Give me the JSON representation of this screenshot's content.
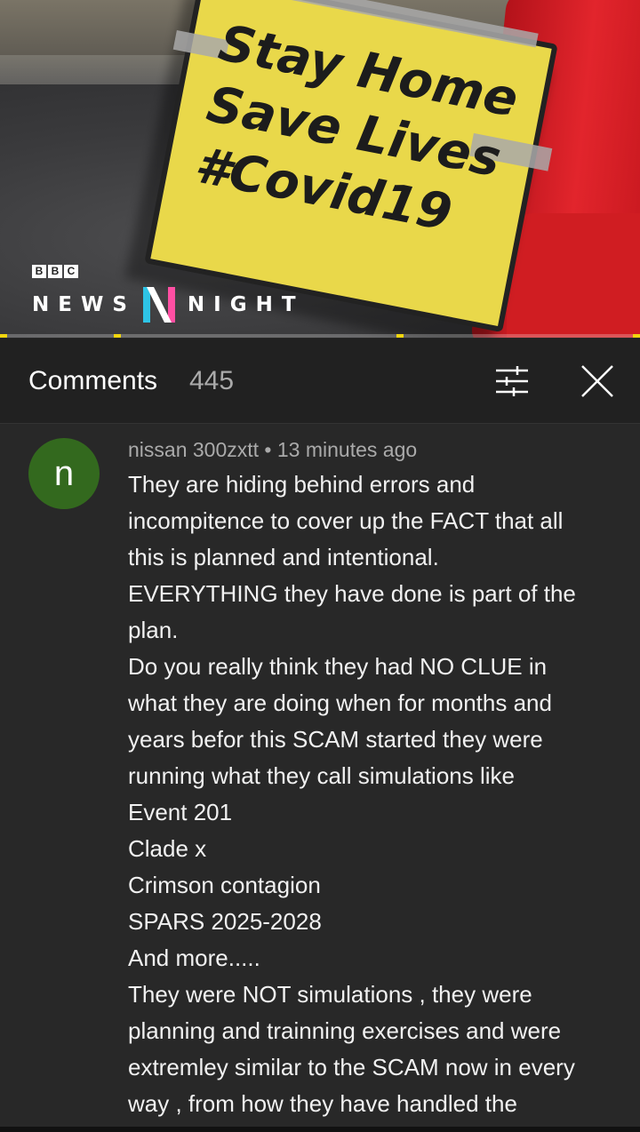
{
  "video": {
    "sign_lines": [
      "Stay Home",
      "Save Lives",
      "#Covid19"
    ],
    "brand": {
      "bbc_letters": [
        "B",
        "B",
        "C"
      ],
      "news": "NEWS",
      "night": "NIGHT"
    }
  },
  "comments_header": {
    "title": "Comments",
    "count": "445",
    "sort_icon": "sort-filter-icon",
    "close_icon": "close-icon"
  },
  "comment": {
    "avatar_letter": "n",
    "avatar_color": "#33691e",
    "author": "nissan 300zxtt",
    "separator": "•",
    "time": "13 minutes ago",
    "lines": [
      "They are hiding behind errors and",
      "incompitence to cover up the FACT that all",
      "this is planned and intentional.",
      "EVERYTHING they have done is part of the",
      "plan.",
      "Do you really think they had NO CLUE in",
      "what they are doing when for months and",
      "years befor this SCAM started they were",
      "running what they call simulations like",
      "Event 201",
      "Clade x",
      "Crimson contagion",
      "SPARS 2025-2028",
      "And more.....",
      "They were NOT simulations , they were",
      "planning and trainning exercises and were",
      "extremley similar to the SCAM now in every",
      "way , from how they have handled the"
    ]
  }
}
